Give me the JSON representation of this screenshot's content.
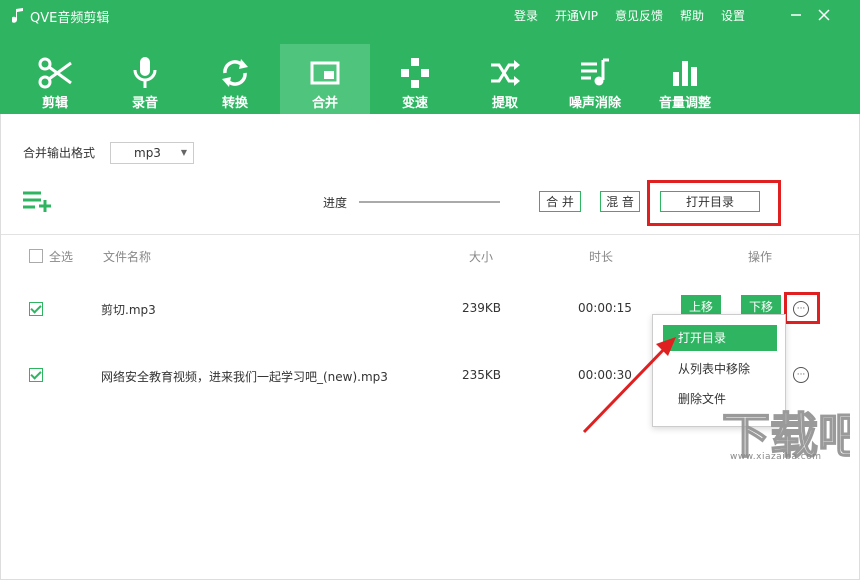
{
  "app": {
    "title": "QVE音频剪辑"
  },
  "top_links": [
    "登录",
    "开通VIP",
    "意见反馈",
    "帮助",
    "设置"
  ],
  "toolbar": [
    {
      "label": "剪辑",
      "icon": "scissors-icon"
    },
    {
      "label": "录音",
      "icon": "microphone-icon"
    },
    {
      "label": "转换",
      "icon": "refresh-icon"
    },
    {
      "label": "合并",
      "icon": "merge-icon",
      "active": true
    },
    {
      "label": "变速",
      "icon": "gamepad-icon"
    },
    {
      "label": "提取",
      "icon": "shuffle-icon"
    },
    {
      "label": "噪声消除",
      "icon": "music-list-icon"
    },
    {
      "label": "音量调整",
      "icon": "bar-chart-icon"
    }
  ],
  "output_format": {
    "label": "合并输出格式",
    "value": "mp3"
  },
  "progress": {
    "label": "进度",
    "value": 0
  },
  "buttons": {
    "merge": "合 并",
    "mix": "混 音",
    "open_dir": "打开目录"
  },
  "table": {
    "headers": {
      "select_all": "全选",
      "name": "文件名称",
      "size": "大小",
      "duration": "时长",
      "actions": "操作"
    },
    "rows": [
      {
        "checked": true,
        "name": "剪切.mp3",
        "size": "239KB",
        "duration": "00:00:15",
        "up": "上移",
        "down": "下移"
      },
      {
        "checked": true,
        "name": "网络安全教育视频，进来我们一起学习吧_(new).mp3",
        "size": "235KB",
        "duration": "00:00:30"
      }
    ]
  },
  "context_menu": [
    "打开目录",
    "从列表中移除",
    "删除文件"
  ],
  "watermark": {
    "text": "下载吧",
    "sub": "www.xiazaiba.com"
  },
  "colors": {
    "brand": "#2fb562",
    "annotation": "#e02020"
  }
}
